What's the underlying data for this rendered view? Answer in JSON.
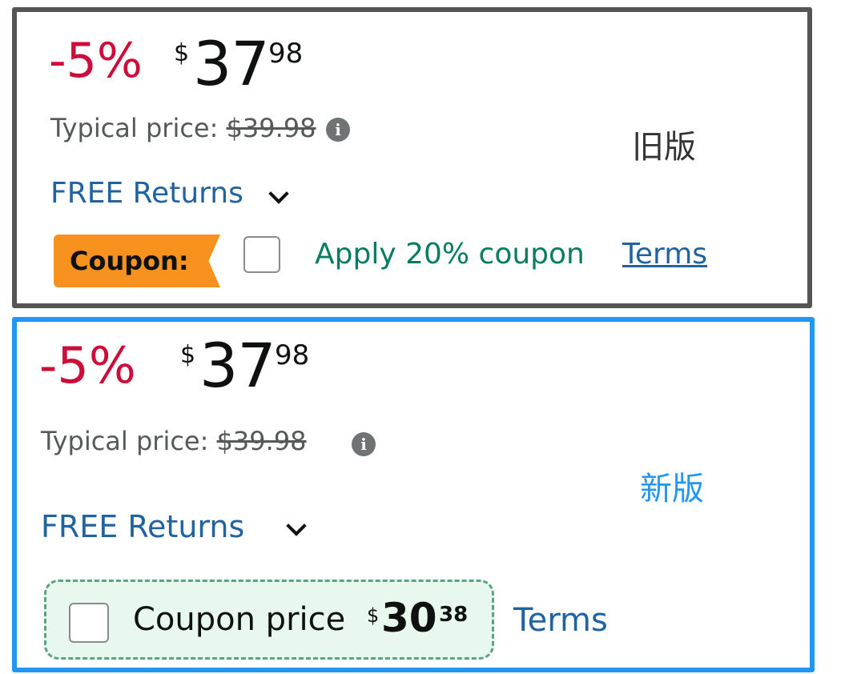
{
  "old_version": {
    "label": "旧版",
    "discount": "-5%",
    "price": {
      "symbol": "$",
      "whole": "37",
      "fraction": "98"
    },
    "typical": {
      "label": "Typical price:",
      "value": "$39.98"
    },
    "info_icon": "info-icon",
    "returns": "FREE Returns",
    "coupon": {
      "badge": "Coupon:",
      "apply_text": "Apply 20% coupon",
      "terms": "Terms",
      "checked": false
    }
  },
  "new_version": {
    "label": "新版",
    "discount": "-5%",
    "price": {
      "symbol": "$",
      "whole": "37",
      "fraction": "98"
    },
    "typical": {
      "label": "Typical price:",
      "value": "$39.98"
    },
    "info_icon": "info-icon",
    "returns": "FREE Returns",
    "coupon": {
      "label": "Coupon price",
      "price": {
        "symbol": "$",
        "whole": "30",
        "fraction": "38"
      },
      "terms": "Terms",
      "checked": false
    }
  },
  "colors": {
    "old_border": "#555555",
    "new_border": "#2196F3",
    "discount": "#CC0C39",
    "link": "#2162A1",
    "coupon_badge": "#F7921E",
    "coupon_apply": "#067D62",
    "coupon_box_bg": "#E8F8EE"
  }
}
